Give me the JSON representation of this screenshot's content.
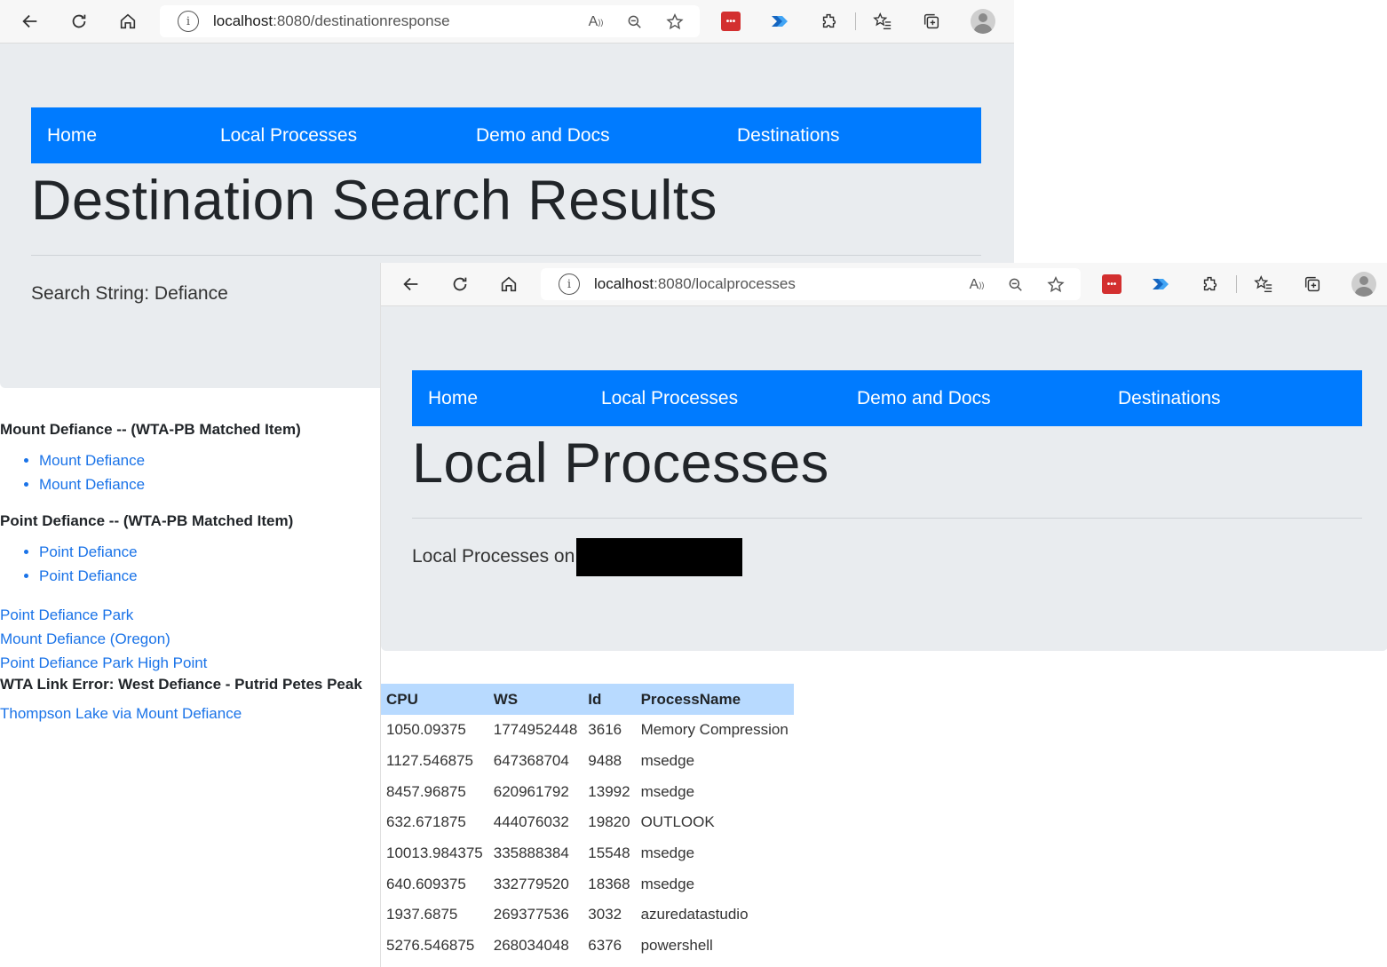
{
  "windows": [
    {
      "url_host": "localhost",
      "url_path": ":8080/destinationresponse",
      "nav": [
        "Home",
        "Local Processes",
        "Demo and Docs",
        "Destinations"
      ],
      "title": "Destination Search Results",
      "lead": "Search String: Defiance",
      "results": {
        "group1_heading": "Mount Defiance -- (WTA-PB Matched Item)",
        "group1_links": [
          "Mount Defiance",
          "Mount Defiance"
        ],
        "group2_heading": "Point Defiance -- (WTA-PB Matched Item)",
        "group2_links": [
          "Point Defiance",
          "Point Defiance"
        ],
        "links": [
          "Point Defiance Park",
          "Mount Defiance (Oregon)",
          "Point Defiance Park High Point"
        ],
        "error": "WTA Link Error: West Defiance - Putrid Petes Peak",
        "last_link": "Thompson Lake via Mount Defiance"
      }
    },
    {
      "url_host": "localhost",
      "url_path": ":8080/localprocesses",
      "nav": [
        "Home",
        "Local Processes",
        "Demo and Docs",
        "Destinations"
      ],
      "title": "Local Processes",
      "lead": "Local Processes on",
      "table": {
        "headers": [
          "CPU",
          "WS",
          "Id",
          "ProcessName"
        ],
        "rows": [
          [
            "1050.09375",
            "1774952448",
            "3616",
            "Memory Compression"
          ],
          [
            "1127.546875",
            "647368704",
            "9488",
            "msedge"
          ],
          [
            "8457.96875",
            "620961792",
            "13992",
            "msedge"
          ],
          [
            "632.671875",
            "444076032",
            "19820",
            "OUTLOOK"
          ],
          [
            "10013.984375",
            "335888384",
            "15548",
            "msedge"
          ],
          [
            "640.609375",
            "332779520",
            "18368",
            "msedge"
          ],
          [
            "1937.6875",
            "269377536",
            "3032",
            "azuredatastudio"
          ],
          [
            "5276.546875",
            "268034048",
            "6376",
            "powershell"
          ]
        ]
      }
    }
  ],
  "colors": {
    "nav_bg": "#007bff",
    "jumbo_bg": "#e9ecef",
    "link": "#1a73e8",
    "table_header": "#b8daff"
  },
  "icons": [
    "back-icon",
    "refresh-icon",
    "home-icon",
    "info-icon",
    "read-aloud-icon",
    "zoom-out-icon",
    "add-favorite-icon",
    "lastpass-icon",
    "power-automate-icon",
    "extensions-icon",
    "favorites-icon",
    "collections-icon",
    "profile-avatar-icon"
  ]
}
